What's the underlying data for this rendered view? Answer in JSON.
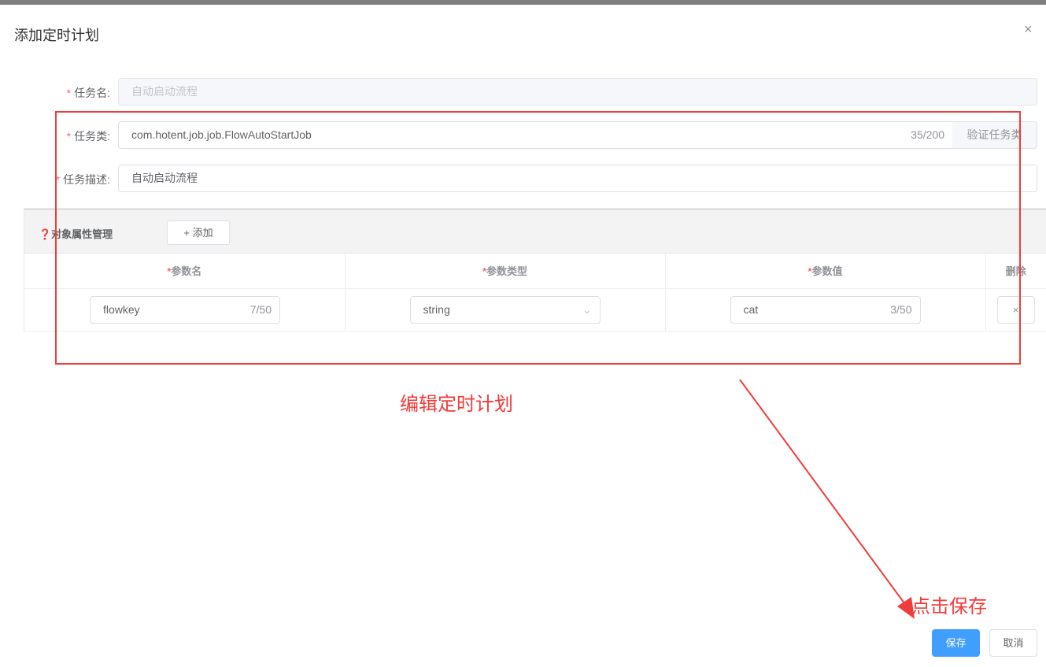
{
  "dialog": {
    "title": "添加定时计划",
    "close_icon": "×"
  },
  "form": {
    "required_mark": "*",
    "task_name": {
      "label": "任务名:",
      "value": "自动启动流程"
    },
    "task_class": {
      "label": "任务类:",
      "value": "com.hotent.job.job.FlowAutoStartJob",
      "count": "35/200",
      "verify_button": "验证任务类"
    },
    "task_desc": {
      "label": "任务描述:",
      "value": "自动启动流程"
    }
  },
  "params": {
    "title": "❓对象属性管理",
    "add_button": "+ 添加",
    "columns": [
      "参数名",
      "参数类型",
      "参数值",
      "删除"
    ],
    "rows": [
      {
        "name": "flowkey",
        "name_count": "7/50",
        "type": "string",
        "value": "cat",
        "value_count": "3/50",
        "delete": "×"
      }
    ]
  },
  "annotations": {
    "edit": "编辑定时计划",
    "save": "点击保存"
  },
  "footer": {
    "save": "保存",
    "cancel": "取消"
  }
}
